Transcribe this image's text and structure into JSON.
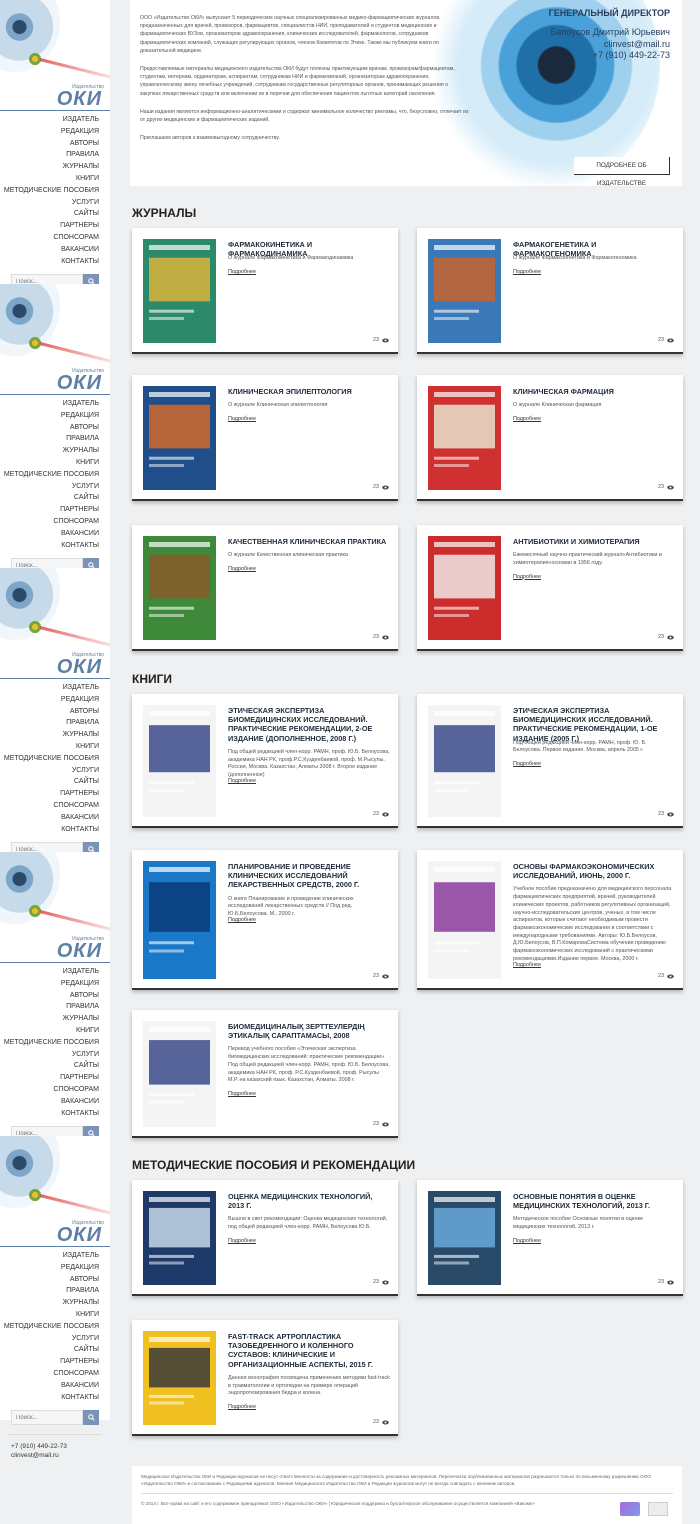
{
  "brand": {
    "logo_sub": "Издательство",
    "logo": "ОКИ"
  },
  "nav": [
    "ИЗДАТЕЛЬ",
    "РЕДАКЦИЯ",
    "АВТОРЫ",
    "ПРАВИЛА",
    "ЖУРНАЛЫ",
    "КНИГИ",
    "МЕТОДИЧЕСКИЕ ПОСОБИЯ",
    "УСЛУГИ",
    "САЙТЫ",
    "ПАРТНЕРЫ",
    "СПОНСОРАМ",
    "ВАКАНСИИ",
    "КОНТАКТЫ"
  ],
  "search": {
    "placeholder": "Поиск..."
  },
  "contact": {
    "phone": "+7 (910) 449-22-73",
    "email": "clinvest@mail.ru"
  },
  "hero": {
    "p1": "ООО «Издательство ОКИ» выпускает 5 периодических научных специализированных медико-фармацевтических журналов, предназначенных для врачей, провизоров, фармацевтов, специалистов НИИ, преподавателей и студентов медицинских и фармацевтических ВУЗов, организаторов здравоохранения, клинических исследователей, фармакологов, сотрудников фармацевтических компаний, служащих регулирующих органов, членов Комитетов по Этике. Также мы публикуем книги по доказательной медицине.",
    "p2": "Предоставляемые материалы медицинского издательства ОКИ будут полезны практикующим врачам, провизорам/фармацевтам, студентам, интернам, ординаторам, аспирантам, сотрудникам НИИ и фармкомпаний, организаторам здравоохранения, управленческому звену лечебных учреждений, сотрудникам государственных регуляторных органов, принимающих решения о закупках лекарственных средств или включении их в перечни для обеспечения пациентов льготных категорий населения.",
    "p3": "Наши издания являются информационно-аналитическими и содержат минимальное количество рекламы, что, безусловно, отличает их от других медицинских и фармацевтических изданий.",
    "p4": "Приглашаем авторов к взаимовыгодному сотрудничеству.",
    "director_title": "ГЕНЕРАЛЬНЫЙ ДИРЕКТОР",
    "director_name": "Белоусов Дмитрий Юрьевич",
    "director_email": "clinvest@mail.ru",
    "director_phone": "+7 (910) 449-22-73",
    "more_btn": "ПОДРОБНЕЕ ОБ ИЗДАТЕЛЬСТВЕ"
  },
  "sections": {
    "journals": "ЖУРНАЛЫ",
    "books": "КНИГИ",
    "guides": "МЕТОДИЧЕСКИЕ ПОСОБИЯ И РЕКОМЕНДАЦИИ"
  },
  "more_label": "Подробнее",
  "cards": [
    {
      "title": "ФАРМАКОКИНЕТИКА И ФАРМАКОДИНАМИКА",
      "desc": "О журнале Фармакокинетика и Фармакодинамика",
      "views": "23",
      "cover": "#2c8a6a",
      "accent": "#d8b43c"
    },
    {
      "title": "ФАРМАКОГЕНЕТИКА И ФАРМАКОГЕНОМИКА",
      "desc": "О журнале Фармакогенетика и Фармакогеномика",
      "views": "23",
      "cover": "#3a78b8",
      "accent": "#c8642a"
    },
    {
      "title": "КЛИНИЧЕСКАЯ ЭПИЛЕПТОЛОГИЯ",
      "desc": "О журнале Клиническая эпилептология",
      "views": "23",
      "cover": "#1f4e8a",
      "accent": "#d06a2a"
    },
    {
      "title": "КЛИНИЧЕСКАЯ ФАРМАЦИЯ",
      "desc": "О журнале Клиническая фармация",
      "views": "23",
      "cover": "#cf3030",
      "accent": "#e8e2cc"
    },
    {
      "title": "КАЧЕСТВЕННАЯ КЛИНИЧЕСКАЯ ПРАКТИКА",
      "desc": "О журнале Качественная клиническая практика",
      "views": "23",
      "cover": "#3e8a3a",
      "accent": "#8a5a2a"
    },
    {
      "title": "АНТИБИОТИКИ И ХИМИОТЕРАПИЯ",
      "desc": "Ежемесячный научно-практический журнал«Антибиотики и химиотерапия»основан в 1956 году.",
      "views": "23",
      "cover": "#cc2c2c",
      "accent": "#f0e6e6"
    },
    {
      "title": "ЭТИЧЕСКАЯ ЭКСПЕРТИЗА БИОМЕДИЦИНСКИХ ИССЛЕДОВАНИЙ. ПРАКТИЧЕСКИЕ РЕКОМЕНДАЦИИ, 2-ОЕ ИЗДАНИЕ (ДОПОЛНЕННОЕ, 2008 Г.)",
      "desc": "Под общей редакцией член-корр. РАМН, проф. Ю.Б. Белоусова, академика НАН РК, проф.Р.С.Кузденбаевой, проф. М.Рысулы. Россия, Москва. Казахстан, Алматы 2008 г. Второе издание (дополненное)",
      "views": "23",
      "cover": "#f4f4f4",
      "accent": "#3a4a8a"
    },
    {
      "title": "ЭТИЧЕСКАЯ ЭКСПЕРТИЗА БИОМЕДИЦИНСКИХ ИССЛЕДОВАНИЙ. ПРАКТИЧЕСКИЕ РЕКОМЕНДАЦИИ, 1-ОЕ ИЗДАНИЕ (2005 Г.)",
      "desc": "Под общей редакцией член-корр. РАМН, проф. Ю. Б. Белоусова. Первое издание. Москва, апрель 2005 г.",
      "views": "23",
      "cover": "#f4f4f4",
      "accent": "#3a4a8a"
    },
    {
      "title": "ПЛАНИРОВАНИЕ И ПРОВЕДЕНИЕ КЛИНИЧЕСКИХ ИССЛЕДОВАНИЙ ЛЕКАРСТВЕННЫХ СРЕДСТВ, 2000 Г.",
      "desc": "О книге Планирование и проведение клинических исследований лекарственных средств // Под ред. Ю.Б.Белоусова. М., 2000 г.",
      "views": "23",
      "cover": "#1a78c8",
      "accent": "#0a3a78"
    },
    {
      "title": "ОСНОВЫ ФАРМАКОЭКОНОМИЧЕСКИХ ИССЛЕДОВАНИЙ, ИЮНЬ, 2000 Г.",
      "desc": "Учебное пособие предназначено для медицинского персонала фармацевтических предприятий, врачей, руководителей клинических проектов, работников регулятивных организаций, научно-исследовательских центров, ученых, в том числе аспирантов, которые считают необходимым провести фармакоэкономические исследования в соответствии с международными требованиями. Авторы: Ю.Б.Белоусов, Д.Ю.Белоусов, В.П.КомароваСистема обучения проведению фармакоэкономических исследований с практическими рекомендациями.Издание первое. Москва, 2000 г.",
      "views": "23",
      "cover": "#f4f4f4",
      "accent": "#8a3a9a"
    },
    {
      "title": "БИОМЕДИЦИНАЛЫҚ ЗЕРТТЕУЛЕРДІҢ ЭТИКАЛЫҚ САРАПТАМАСЫ, 2008",
      "desc": "Перевод учебного пособия «Этическая экспертиза биомедицинских исследований: практические рекомендации» Под общей редакцией член-корр. РАМН, проф. Ю.Б. Белоусова, академика НАН РК, проф. Р.С.Кузденбаевой, проф. Рысулы М.Р. на казахский язык. Казахстан, Алматы. 2008 г.",
      "views": "23",
      "cover": "#f4f4f4",
      "accent": "#3a4a8a"
    },
    {
      "title": "ОЦЕНКА МЕДИЦИНСКИХ ТЕХНОЛОГИЙ, 2013 Г.",
      "desc": "Вышли в свет рекомендации: Оценка медицинских технологий, под общей редакцией член-корр. РАМН, Белоусова Ю.Б.",
      "views": "23",
      "cover": "#1e3a6a",
      "accent": "#c8d8e8"
    },
    {
      "title": "ОСНОВНЫЕ ПОНЯТИЯ В ОЦЕНКЕ МЕДИЦИНСКИХ ТЕХНОЛОГИЙ, 2013 Г.",
      "desc": "Методическое пособие Основные понятия в оценке медицинских технологий, 2013 г.",
      "views": "23",
      "cover": "#2a4a6a",
      "accent": "#6aa8d8"
    },
    {
      "title": "FAST-TRACK АРТРОПЛАСТИКА ТАЗОБЕДРЕННОГО И КОЛЕННОГО СУСТАВОВ: КЛИНИЧЕСКИЕ И ОРГАНИЗАЦИОННЫЕ АСПЕКТЫ, 2015 Г.",
      "desc": "Данная монография посвящена применению методики fast-track в травматологии и ортопедии на примере операций эндопротезирования бедра и колена.",
      "views": "23",
      "cover": "#f0c020",
      "accent": "#3a3a3a"
    }
  ],
  "footer": {
    "line1": "Медицинское Издательство ОКИ и Редакции журналов не несут ответственности за содержание и достоверность рекламных материалов. Перепечатка опубликованных материалов разрешается только по письменному разрешению ООО «Издательство ОКИ» и согласованию с Редакциями журналов. Мнение Медицинского Издательства ОКИ и Редакции журналов могут не всегда совпадать с мнением авторов.",
    "line2": "© 2014 г. Все права на сайт и его содержимое принадлежат ООО «Издательство ОКИ» | Юридическая поддержка и бухгалтерское обслуживание осуществляется компанией «Викомп»"
  }
}
